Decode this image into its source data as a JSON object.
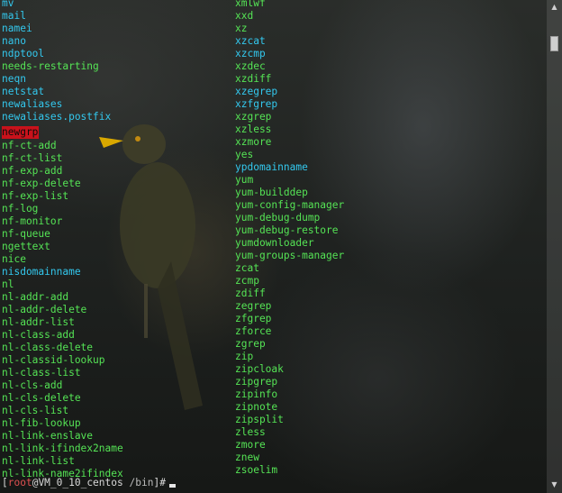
{
  "colors": {
    "text_cyan": "#33c8ee",
    "text_green": "#55e455",
    "highlight_red": "#c8121b"
  },
  "left_column": [
    {
      "text": "mv",
      "style": "cyan"
    },
    {
      "text": "mail",
      "style": "cyan"
    },
    {
      "text": "namei",
      "style": "cyan"
    },
    {
      "text": "nano",
      "style": "cyan"
    },
    {
      "text": "ndptool",
      "style": "cyan"
    },
    {
      "text": "needs-restarting",
      "style": "green"
    },
    {
      "text": "neqn",
      "style": "cyan"
    },
    {
      "text": "netstat",
      "style": "cyan"
    },
    {
      "text": "newaliases",
      "style": "cyan"
    },
    {
      "text": "newaliases.postfix",
      "style": "cyan"
    },
    {
      "text": "newgrp",
      "style": "highlight"
    },
    {
      "text": "nf-ct-add",
      "style": "green"
    },
    {
      "text": "nf-ct-list",
      "style": "green"
    },
    {
      "text": "nf-exp-add",
      "style": "green"
    },
    {
      "text": "nf-exp-delete",
      "style": "green"
    },
    {
      "text": "nf-exp-list",
      "style": "green"
    },
    {
      "text": "nf-log",
      "style": "green"
    },
    {
      "text": "nf-monitor",
      "style": "green"
    },
    {
      "text": "nf-queue",
      "style": "green"
    },
    {
      "text": "ngettext",
      "style": "green"
    },
    {
      "text": "nice",
      "style": "green"
    },
    {
      "text": "nisdomainname",
      "style": "cyan"
    },
    {
      "text": "nl",
      "style": "green"
    },
    {
      "text": "nl-addr-add",
      "style": "green"
    },
    {
      "text": "nl-addr-delete",
      "style": "green"
    },
    {
      "text": "nl-addr-list",
      "style": "green"
    },
    {
      "text": "nl-class-add",
      "style": "green"
    },
    {
      "text": "nl-class-delete",
      "style": "green"
    },
    {
      "text": "nl-classid-lookup",
      "style": "green"
    },
    {
      "text": "nl-class-list",
      "style": "green"
    },
    {
      "text": "nl-cls-add",
      "style": "green"
    },
    {
      "text": "nl-cls-delete",
      "style": "green"
    },
    {
      "text": "nl-cls-list",
      "style": "green"
    },
    {
      "text": "nl-fib-lookup",
      "style": "green"
    },
    {
      "text": "nl-link-enslave",
      "style": "green"
    },
    {
      "text": "nl-link-ifindex2name",
      "style": "green"
    },
    {
      "text": "nl-link-list",
      "style": "green"
    },
    {
      "text": "nl-link-name2ifindex",
      "style": "green"
    }
  ],
  "right_column": [
    {
      "text": "xmlwf",
      "style": "green"
    },
    {
      "text": "xxd",
      "style": "green"
    },
    {
      "text": "xz",
      "style": "green"
    },
    {
      "text": "xzcat",
      "style": "cyan"
    },
    {
      "text": "xzcmp",
      "style": "cyan"
    },
    {
      "text": "xzdec",
      "style": "green"
    },
    {
      "text": "xzdiff",
      "style": "green"
    },
    {
      "text": "xzegrep",
      "style": "cyan"
    },
    {
      "text": "xzfgrep",
      "style": "cyan"
    },
    {
      "text": "xzgrep",
      "style": "green"
    },
    {
      "text": "xzless",
      "style": "green"
    },
    {
      "text": "xzmore",
      "style": "green"
    },
    {
      "text": "yes",
      "style": "green"
    },
    {
      "text": "ypdomainname",
      "style": "cyan"
    },
    {
      "text": "yum",
      "style": "green"
    },
    {
      "text": "yum-builddep",
      "style": "green"
    },
    {
      "text": "yum-config-manager",
      "style": "green"
    },
    {
      "text": "yum-debug-dump",
      "style": "green"
    },
    {
      "text": "yum-debug-restore",
      "style": "green"
    },
    {
      "text": "yumdownloader",
      "style": "green"
    },
    {
      "text": "yum-groups-manager",
      "style": "green"
    },
    {
      "text": "zcat",
      "style": "green"
    },
    {
      "text": "zcmp",
      "style": "green"
    },
    {
      "text": "zdiff",
      "style": "green"
    },
    {
      "text": "zegrep",
      "style": "green"
    },
    {
      "text": "zfgrep",
      "style": "green"
    },
    {
      "text": "zforce",
      "style": "green"
    },
    {
      "text": "zgrep",
      "style": "green"
    },
    {
      "text": "zip",
      "style": "green"
    },
    {
      "text": "zipcloak",
      "style": "green"
    },
    {
      "text": "zipgrep",
      "style": "green"
    },
    {
      "text": "zipinfo",
      "style": "green"
    },
    {
      "text": "zipnote",
      "style": "green"
    },
    {
      "text": "zipsplit",
      "style": "green"
    },
    {
      "text": "zless",
      "style": "green"
    },
    {
      "text": "zmore",
      "style": "green"
    },
    {
      "text": "znew",
      "style": "green"
    },
    {
      "text": "zsoelim",
      "style": "green"
    }
  ],
  "prompt": {
    "open_bracket": "[",
    "user": "root",
    "at_host": "@VM_0_10_centos",
    "directory": "/bin",
    "close": "]#"
  },
  "scrollbar": {
    "up_icon": "▲",
    "down_icon": "▼"
  }
}
